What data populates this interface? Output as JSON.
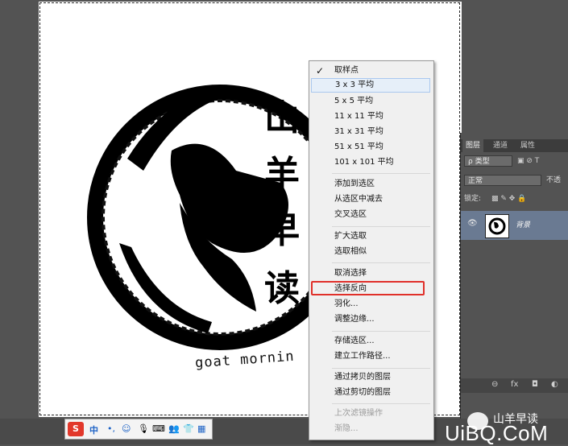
{
  "context_menu": {
    "items": [
      {
        "label": "取样点",
        "checked": true
      },
      {
        "label": "3 x 3 平均",
        "highlighted": true
      },
      {
        "label": "5 x 5 平均"
      },
      {
        "label": "11 x 11 平均"
      },
      {
        "label": "31 x 31 平均"
      },
      {
        "label": "51 x 51 平均"
      },
      {
        "label": "101 x 101 平均"
      },
      {
        "label": "添加到选区"
      },
      {
        "label": "从选区中减去"
      },
      {
        "label": "交叉选区"
      },
      {
        "label": "扩大选取"
      },
      {
        "label": "选取相似"
      },
      {
        "label": "取消选择"
      },
      {
        "label": "选择反向"
      },
      {
        "label": "羽化..."
      },
      {
        "label": "调整边缘..."
      },
      {
        "label": "存储选区..."
      },
      {
        "label": "建立工作路径..."
      },
      {
        "label": "通过拷贝的图层"
      },
      {
        "label": "通过剪切的图层"
      },
      {
        "label": "上次滤镜操作",
        "disabled": true
      },
      {
        "label": "渐隐...",
        "disabled": true
      }
    ]
  },
  "canvas": {
    "logo_chars": [
      "山",
      "羊",
      "早",
      "读"
    ],
    "logo_caption": "goat mornin"
  },
  "layers_panel": {
    "tabs": [
      "图层",
      "通道",
      "属性"
    ],
    "filter_label": "ρ 类型",
    "filter_icons": "▣ ⊘ T",
    "blend_mode": "正常",
    "opacity_label": "不透",
    "lock_label": "锁定:",
    "lock_icons": "▩ ✎ ✥ 🔒",
    "layer_name": "背景",
    "bottom_icons": [
      "⊖",
      "fx",
      "◘",
      "◐"
    ]
  },
  "ime_toolbar": {
    "logo": "S",
    "items": [
      "中",
      "•,",
      "☺",
      "🎙",
      "⌨",
      "👥",
      "👕",
      "▦"
    ]
  },
  "watermark": {
    "line1": "山羊早读",
    "line2": "UiBQ.CoM"
  },
  "colors": {
    "highlight_border": "#e0302a",
    "menu_bg": "#f0f0f0",
    "panel_bg": "#535353",
    "layer_selected": "#6a7a92"
  }
}
